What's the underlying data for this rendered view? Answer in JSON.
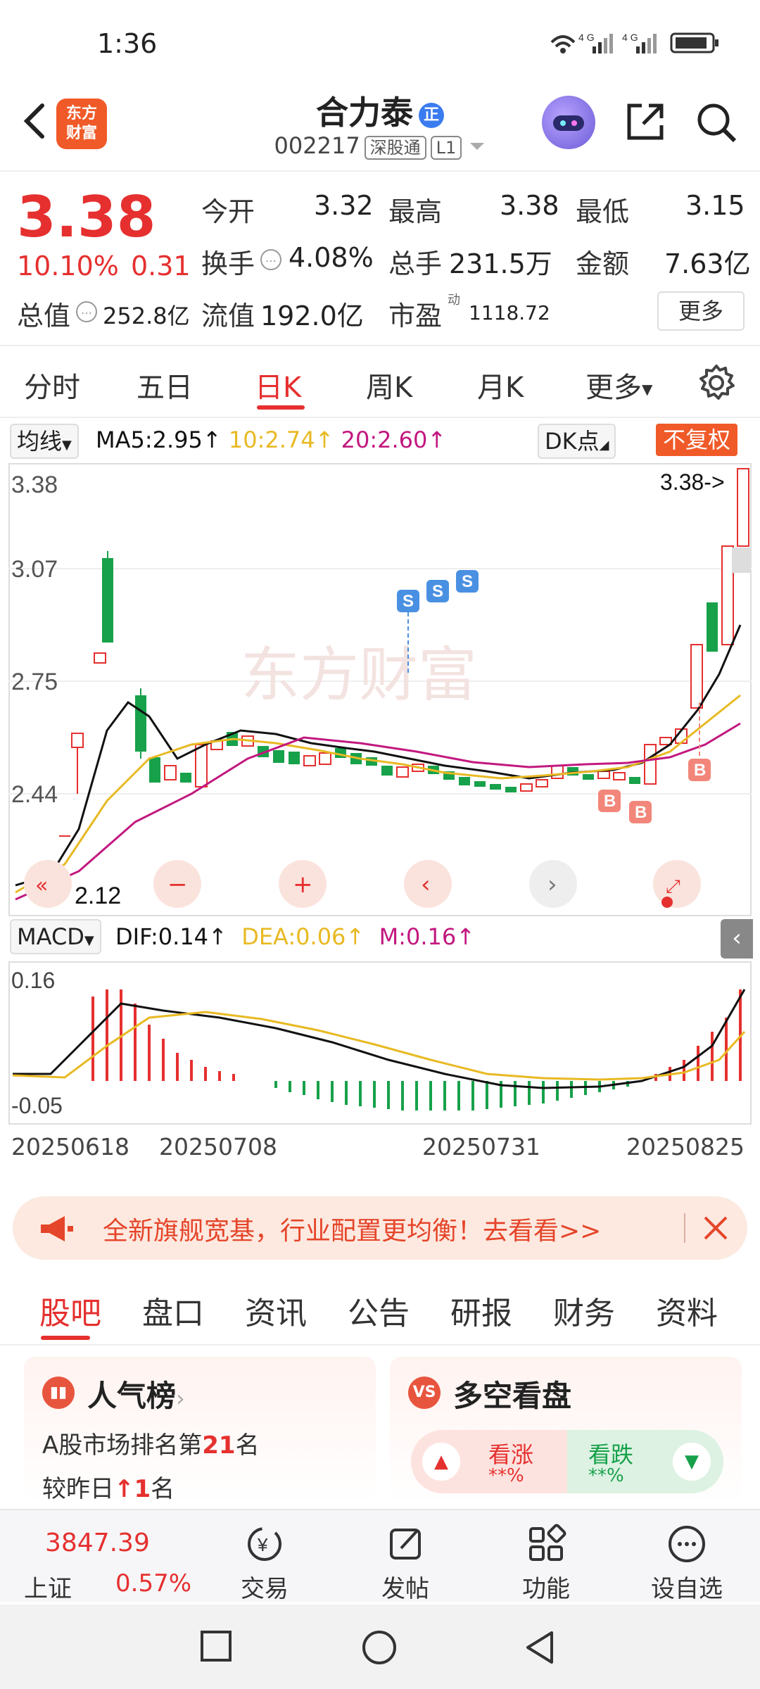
{
  "status": {
    "time": "1:36",
    "icons_text": "4G 4G"
  },
  "header": {
    "logo_text": "东方\n财富",
    "name": "合力泰",
    "name_badge": "正",
    "code": "002217",
    "tag1": "深股通",
    "tag2": "L1"
  },
  "quote": {
    "price": "3.38",
    "pct": "10.10%",
    "chg": "0.31",
    "open_label": "今开",
    "open": "3.32",
    "high_label": "最高",
    "high": "3.38",
    "low_label": "最低",
    "low": "3.15",
    "turnover_label": "换手",
    "turnover": "4.08%",
    "vol_label": "总手",
    "vol": "231.5万",
    "amount_label": "金额",
    "amount": "7.63亿",
    "mktcap_label": "总值",
    "mktcap": "252.8亿",
    "float_label": "流值",
    "float": "192.0亿",
    "pe_label": "市盈",
    "pe_sup": "动",
    "pe": "1118.72",
    "more": "更多"
  },
  "period_tabs": [
    "分时",
    "五日",
    "日K",
    "周K",
    "月K",
    "更多"
  ],
  "ma_bar": {
    "chip": "均线",
    "ma5": "MA5:2.95",
    "ma10": "10:2.74",
    "ma20": "20:2.60",
    "dk": "DK点",
    "fq": "不复权"
  },
  "kchart": {
    "y_labels": [
      "3.38",
      "3.07",
      "2.75",
      "2.44"
    ],
    "last_price_tag": "3.38->",
    "low_tag": "2.12",
    "watermark": "东方财富",
    "bs_marks": [
      "S",
      "S",
      "S",
      "B",
      "B",
      "B"
    ]
  },
  "macd": {
    "chip": "MACD",
    "dif": "DIF:0.14",
    "dea": "DEA:0.06",
    "m": "M:0.16",
    "y_top": "0.16",
    "y_bottom": "-0.05"
  },
  "dates": [
    "20250618",
    "20250708",
    "20250731",
    "20250825"
  ],
  "promo": {
    "text": "全新旗舰宽基，行业配置更均衡！去看看>>"
  },
  "info_tabs": [
    "股吧",
    "盘口",
    "资讯",
    "公告",
    "研报",
    "财务",
    "资料"
  ],
  "hot_card": {
    "title": "人气榜",
    "line1_prefix": "A股市场排名第",
    "rank": "21",
    "line1_suffix": "名",
    "line2_prefix": "较昨日",
    "change": "1",
    "line2_suffix": "名"
  },
  "ls_card": {
    "title": "多空看盘",
    "bull": "看涨",
    "bull_val": "**%",
    "bear": "看跌",
    "bear_val": "**%"
  },
  "bottom_nav": {
    "index_value": "3847.39",
    "index_name": "上证",
    "index_pct": "0.57%",
    "items": [
      "交易",
      "发帖",
      "功能",
      "设自选"
    ]
  },
  "colors": {
    "accent": "#e5302f",
    "brand": "#f05a28",
    "up": "#e5302f",
    "down": "#17a14a",
    "ma5": "#111111",
    "ma10": "#e8b923",
    "ma20": "#c2187f"
  },
  "chart_data": {
    "type": "candlestick",
    "x_ticks": [
      "20250618",
      "20250708",
      "20250731",
      "20250825"
    ],
    "ylim": [
      2.12,
      3.38
    ],
    "y_ticks": [
      3.38,
      3.07,
      2.75,
      2.44
    ],
    "last": 3.38,
    "candles_close": [
      2.13,
      2.15,
      2.2,
      2.52,
      2.36,
      2.8,
      3.13,
      2.7,
      2.72,
      2.6,
      2.55,
      2.5,
      2.55,
      2.58,
      2.6,
      2.63,
      2.61,
      2.57,
      2.56,
      2.55,
      2.53,
      2.52,
      2.55,
      2.53,
      2.51,
      2.5,
      2.49,
      2.48,
      2.47,
      2.45,
      2.44,
      2.43,
      2.45,
      2.47,
      2.5,
      2.49,
      2.48,
      2.47,
      2.48,
      2.5,
      2.58,
      2.6,
      2.66,
      2.75,
      2.92,
      3.07,
      3.38
    ],
    "ma5": [
      2.14,
      2.16,
      2.24,
      2.4,
      2.52,
      2.62,
      2.7,
      2.66,
      2.59,
      2.56,
      2.57,
      2.58,
      2.59,
      2.59,
      2.6,
      2.6,
      2.59,
      2.58,
      2.57,
      2.56,
      2.55,
      2.54,
      2.53,
      2.52,
      2.51,
      2.5,
      2.49,
      2.48,
      2.47,
      2.46,
      2.45,
      2.45,
      2.46,
      2.47,
      2.48,
      2.48,
      2.48,
      2.49,
      2.5,
      2.53,
      2.56,
      2.6,
      2.66,
      2.74,
      2.83,
      2.95
    ],
    "macd": {
      "dif": 0.14,
      "dea": 0.06,
      "m": 0.16,
      "ylim": [
        -0.05,
        0.16
      ]
    }
  }
}
